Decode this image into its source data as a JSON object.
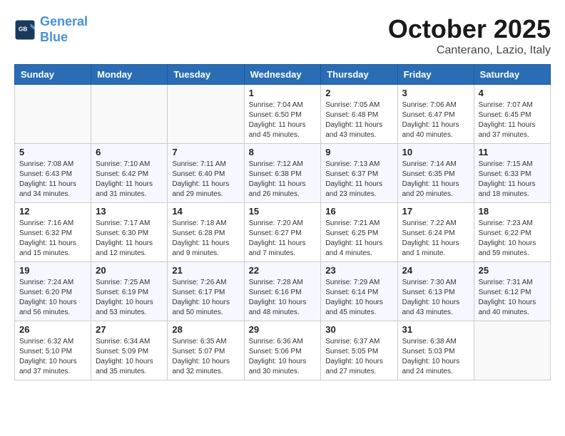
{
  "header": {
    "logo_line1": "General",
    "logo_line2": "Blue",
    "month": "October 2025",
    "location": "Canterano, Lazio, Italy"
  },
  "weekdays": [
    "Sunday",
    "Monday",
    "Tuesday",
    "Wednesday",
    "Thursday",
    "Friday",
    "Saturday"
  ],
  "weeks": [
    [
      {
        "day": "",
        "info": ""
      },
      {
        "day": "",
        "info": ""
      },
      {
        "day": "",
        "info": ""
      },
      {
        "day": "1",
        "info": "Sunrise: 7:04 AM\nSunset: 6:50 PM\nDaylight: 11 hours and 45 minutes."
      },
      {
        "day": "2",
        "info": "Sunrise: 7:05 AM\nSunset: 6:48 PM\nDaylight: 11 hours and 43 minutes."
      },
      {
        "day": "3",
        "info": "Sunrise: 7:06 AM\nSunset: 6:47 PM\nDaylight: 11 hours and 40 minutes."
      },
      {
        "day": "4",
        "info": "Sunrise: 7:07 AM\nSunset: 6:45 PM\nDaylight: 11 hours and 37 minutes."
      }
    ],
    [
      {
        "day": "5",
        "info": "Sunrise: 7:08 AM\nSunset: 6:43 PM\nDaylight: 11 hours and 34 minutes."
      },
      {
        "day": "6",
        "info": "Sunrise: 7:10 AM\nSunset: 6:42 PM\nDaylight: 11 hours and 31 minutes."
      },
      {
        "day": "7",
        "info": "Sunrise: 7:11 AM\nSunset: 6:40 PM\nDaylight: 11 hours and 29 minutes."
      },
      {
        "day": "8",
        "info": "Sunrise: 7:12 AM\nSunset: 6:38 PM\nDaylight: 11 hours and 26 minutes."
      },
      {
        "day": "9",
        "info": "Sunrise: 7:13 AM\nSunset: 6:37 PM\nDaylight: 11 hours and 23 minutes."
      },
      {
        "day": "10",
        "info": "Sunrise: 7:14 AM\nSunset: 6:35 PM\nDaylight: 11 hours and 20 minutes."
      },
      {
        "day": "11",
        "info": "Sunrise: 7:15 AM\nSunset: 6:33 PM\nDaylight: 11 hours and 18 minutes."
      }
    ],
    [
      {
        "day": "12",
        "info": "Sunrise: 7:16 AM\nSunset: 6:32 PM\nDaylight: 11 hours and 15 minutes."
      },
      {
        "day": "13",
        "info": "Sunrise: 7:17 AM\nSunset: 6:30 PM\nDaylight: 11 hours and 12 minutes."
      },
      {
        "day": "14",
        "info": "Sunrise: 7:18 AM\nSunset: 6:28 PM\nDaylight: 11 hours and 9 minutes."
      },
      {
        "day": "15",
        "info": "Sunrise: 7:20 AM\nSunset: 6:27 PM\nDaylight: 11 hours and 7 minutes."
      },
      {
        "day": "16",
        "info": "Sunrise: 7:21 AM\nSunset: 6:25 PM\nDaylight: 11 hours and 4 minutes."
      },
      {
        "day": "17",
        "info": "Sunrise: 7:22 AM\nSunset: 6:24 PM\nDaylight: 11 hours and 1 minute."
      },
      {
        "day": "18",
        "info": "Sunrise: 7:23 AM\nSunset: 6:22 PM\nDaylight: 10 hours and 59 minutes."
      }
    ],
    [
      {
        "day": "19",
        "info": "Sunrise: 7:24 AM\nSunset: 6:20 PM\nDaylight: 10 hours and 56 minutes."
      },
      {
        "day": "20",
        "info": "Sunrise: 7:25 AM\nSunset: 6:19 PM\nDaylight: 10 hours and 53 minutes."
      },
      {
        "day": "21",
        "info": "Sunrise: 7:26 AM\nSunset: 6:17 PM\nDaylight: 10 hours and 50 minutes."
      },
      {
        "day": "22",
        "info": "Sunrise: 7:28 AM\nSunset: 6:16 PM\nDaylight: 10 hours and 48 minutes."
      },
      {
        "day": "23",
        "info": "Sunrise: 7:29 AM\nSunset: 6:14 PM\nDaylight: 10 hours and 45 minutes."
      },
      {
        "day": "24",
        "info": "Sunrise: 7:30 AM\nSunset: 6:13 PM\nDaylight: 10 hours and 43 minutes."
      },
      {
        "day": "25",
        "info": "Sunrise: 7:31 AM\nSunset: 6:12 PM\nDaylight: 10 hours and 40 minutes."
      }
    ],
    [
      {
        "day": "26",
        "info": "Sunrise: 6:32 AM\nSunset: 5:10 PM\nDaylight: 10 hours and 37 minutes."
      },
      {
        "day": "27",
        "info": "Sunrise: 6:34 AM\nSunset: 5:09 PM\nDaylight: 10 hours and 35 minutes."
      },
      {
        "day": "28",
        "info": "Sunrise: 6:35 AM\nSunset: 5:07 PM\nDaylight: 10 hours and 32 minutes."
      },
      {
        "day": "29",
        "info": "Sunrise: 6:36 AM\nSunset: 5:06 PM\nDaylight: 10 hours and 30 minutes."
      },
      {
        "day": "30",
        "info": "Sunrise: 6:37 AM\nSunset: 5:05 PM\nDaylight: 10 hours and 27 minutes."
      },
      {
        "day": "31",
        "info": "Sunrise: 6:38 AM\nSunset: 5:03 PM\nDaylight: 10 hours and 24 minutes."
      },
      {
        "day": "",
        "info": ""
      }
    ]
  ]
}
